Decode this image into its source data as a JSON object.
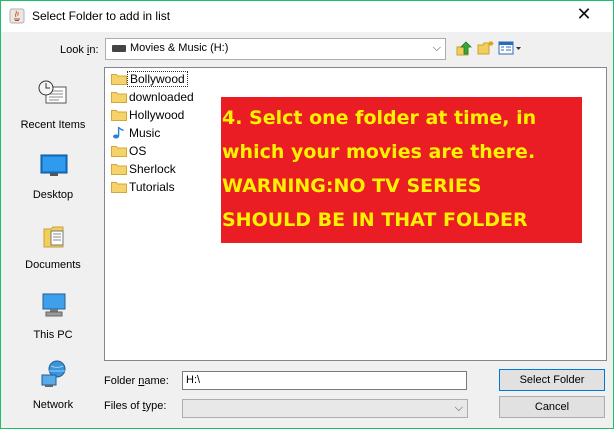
{
  "window": {
    "title": "Select Folder to add in list",
    "close_glyph": "✕"
  },
  "lookin": {
    "label_pre": "Look ",
    "label_mnemonic": "i",
    "label_post": "n:",
    "value": "Movies & Music (H:)",
    "dropdown_glyph": "⌵"
  },
  "toolbar": {
    "icons": [
      "up-one-level-icon",
      "create-new-folder-icon",
      "view-menu-icon"
    ]
  },
  "places": [
    {
      "label": "Recent Items",
      "icon": "recent-items-icon"
    },
    {
      "label": "Desktop",
      "icon": "desktop-icon"
    },
    {
      "label": "Documents",
      "icon": "documents-icon"
    },
    {
      "label": "This PC",
      "icon": "this-pc-icon"
    },
    {
      "label": "Network",
      "icon": "network-icon"
    }
  ],
  "files": [
    {
      "name": "Bollywood",
      "icon": "folder-icon"
    },
    {
      "name": "downloaded",
      "icon": "folder-icon"
    },
    {
      "name": "Hollywood",
      "icon": "folder-icon"
    },
    {
      "name": "Music",
      "icon": "music-note-icon"
    },
    {
      "name": "OS",
      "icon": "folder-icon"
    },
    {
      "name": "Sherlock",
      "icon": "folder-icon"
    },
    {
      "name": "Tutorials",
      "icon": "folder-icon"
    }
  ],
  "annotation": {
    "lines": [
      "4. Selct one folder at time, in",
      "which your movies are there.",
      "WARNING:NO TV SERIES",
      "SHOULD BE IN THAT FOLDER"
    ],
    "background": "#ea1c24",
    "color": "#fff200"
  },
  "folder_name": {
    "label_pre": "Folder ",
    "label_mnemonic": "n",
    "label_post": "ame:",
    "value": "H:\\"
  },
  "files_of_type": {
    "label_pre": "Files of ",
    "label_mnemonic": "t",
    "label_post": "ype:",
    "value": "",
    "dropdown_glyph": "⌵"
  },
  "buttons": {
    "select": "Select Folder",
    "cancel": "Cancel"
  }
}
